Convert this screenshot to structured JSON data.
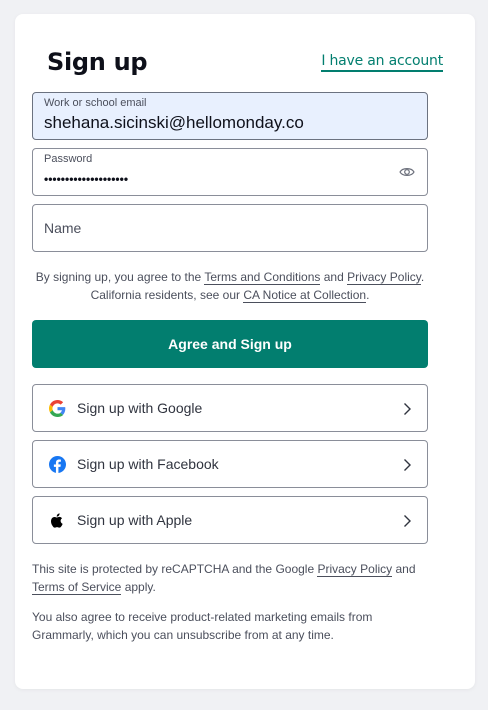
{
  "header": {
    "title": "Sign up",
    "login_link": "I have an account"
  },
  "form": {
    "email": {
      "label": "Work or school email",
      "value": "shehana.sicinski@hellomonday.co"
    },
    "password": {
      "label": "Password",
      "value": "••••••••••••••••••••"
    },
    "name": {
      "placeholder": "Name"
    }
  },
  "legal": {
    "prefix": "By signing up, you agree to the ",
    "terms": "Terms and Conditions",
    "and": " and ",
    "privacy": "Privacy Policy",
    "period": ".",
    "ca_prefix": "California residents, see our ",
    "ca_notice": "CA Notice at Collection",
    "ca_period": "."
  },
  "primary_button": "Agree and Sign up",
  "social": {
    "google": "Sign up with Google",
    "facebook": "Sign up with Facebook",
    "apple": "Sign up with Apple"
  },
  "recaptcha": {
    "prefix": "This site is protected by reCAPTCHA and the Google ",
    "privacy": "Privacy Policy",
    "and": " and",
    "terms": "Terms of Service",
    "suffix": " apply."
  },
  "marketing": "You also agree to receive product-related marketing emails from Grammarly, which you can unsubscribe from at any time.",
  "colors": {
    "accent": "#027e6f",
    "autofill_background": "#e8f0fe",
    "google_blue": "#4285f4",
    "google_red": "#ea4335",
    "google_yellow": "#fbbc05",
    "google_green": "#34a853",
    "facebook_blue": "#1877f2"
  },
  "icons": {
    "password_toggle": "eye-icon",
    "google": "google-icon",
    "facebook": "facebook-icon",
    "apple": "apple-icon",
    "chevron": "chevron-right-icon"
  }
}
